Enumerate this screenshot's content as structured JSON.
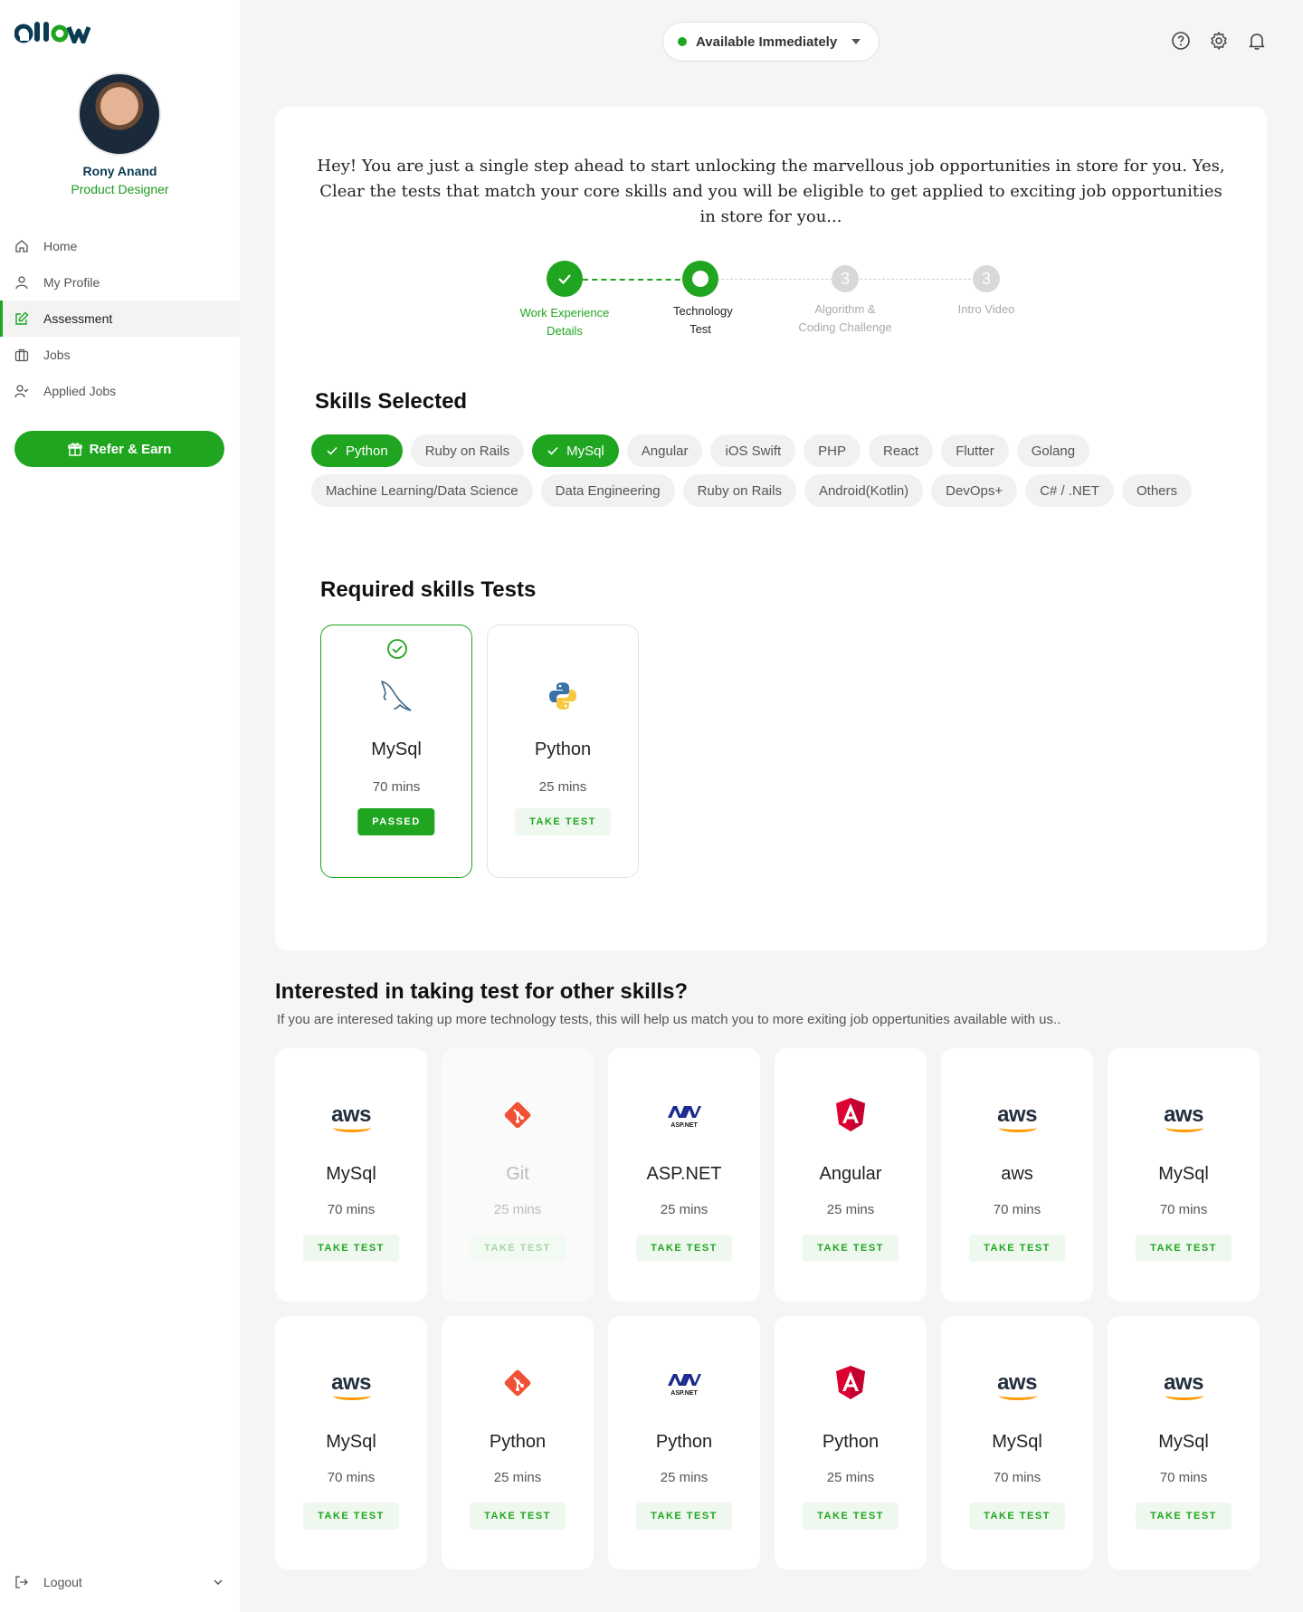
{
  "sidebar": {
    "logo": "ellow",
    "user_name": "Rony Anand",
    "user_role": "Product Designer",
    "nav": [
      {
        "label": "Home",
        "icon": "home-icon"
      },
      {
        "label": "My Profile",
        "icon": "user-icon"
      },
      {
        "label": "Assessment",
        "icon": "edit-icon",
        "active": true
      },
      {
        "label": "Jobs",
        "icon": "briefcase-icon"
      },
      {
        "label": "Applied Jobs",
        "icon": "user-check-icon"
      }
    ],
    "refer_label": "Refer & Earn",
    "logout_label": "Logout"
  },
  "topbar": {
    "availability": "Available Immediately"
  },
  "intro_text": "Hey! You are just a single step ahead to start unlocking the marvellous job opportunities in store for you. Yes, Clear the tests that match your core skills and you will be eligible to get applied to exciting job opportunities in store for you...",
  "steps": [
    {
      "label": "Work Experience Details",
      "state": "done"
    },
    {
      "label": "Technology Test",
      "state": "current"
    },
    {
      "label": "Algorithm & Coding Challenge",
      "state": "future",
      "number": "3"
    },
    {
      "label": "Intro Video",
      "state": "future",
      "number": "3"
    }
  ],
  "skills_title": "Skills Selected",
  "skills": [
    {
      "label": "Python",
      "selected": true
    },
    {
      "label": "Ruby on Rails"
    },
    {
      "label": "MySql",
      "selected": true
    },
    {
      "label": "Angular"
    },
    {
      "label": "iOS Swift"
    },
    {
      "label": "PHP"
    },
    {
      "label": "React"
    },
    {
      "label": "Flutter"
    },
    {
      "label": "Golang"
    },
    {
      "label": "Machine Learning/Data Science"
    },
    {
      "label": "Data Engineering"
    },
    {
      "label": "Ruby on Rails"
    },
    {
      "label": "Android(Kotlin)"
    },
    {
      "label": "DevOps+"
    },
    {
      "label": "C# / .NET"
    },
    {
      "label": "Others"
    }
  ],
  "required_title": "Required skills Tests",
  "required_tests": [
    {
      "name": "MySql",
      "mins": "70 mins",
      "button": "PASSED",
      "logo": "mysql-dolphin-icon",
      "passed": true
    },
    {
      "name": "Python",
      "mins": "25 mins",
      "button": "TAKE TEST",
      "logo": "python-icon"
    }
  ],
  "other_title": "Interested in taking test for other skills?",
  "other_subtitle": "If you are interesed taking up more technology tests, this will help us match you to more exiting job oppertunities available with us..",
  "other_tests": [
    {
      "name": "MySql",
      "mins": "70 mins",
      "button": "TAKE TEST",
      "logo": "aws"
    },
    {
      "name": "Git",
      "mins": "25 mins",
      "button": "TAKE TEST",
      "logo": "git",
      "faded": true
    },
    {
      "name": "ASP.NET",
      "mins": "25 mins",
      "button": "TAKE TEST",
      "logo": "aspnet"
    },
    {
      "name": "Angular",
      "mins": "25 mins",
      "button": "TAKE TEST",
      "logo": "angular"
    },
    {
      "name": "aws",
      "mins": "70 mins",
      "button": "TAKE TEST",
      "logo": "aws"
    },
    {
      "name": "MySql",
      "mins": "70 mins",
      "button": "TAKE TEST",
      "logo": "aws"
    },
    {
      "name": "MySql",
      "mins": "70 mins",
      "button": "TAKE TEST",
      "logo": "aws"
    },
    {
      "name": "Python",
      "mins": "25 mins",
      "button": "TAKE TEST",
      "logo": "git"
    },
    {
      "name": "Python",
      "mins": "25 mins",
      "button": "TAKE TEST",
      "logo": "aspnet"
    },
    {
      "name": "Python",
      "mins": "25 mins",
      "button": "TAKE TEST",
      "logo": "angular"
    },
    {
      "name": "MySql",
      "mins": "70 mins",
      "button": "TAKE TEST",
      "logo": "aws"
    },
    {
      "name": "MySql",
      "mins": "70 mins",
      "button": "TAKE TEST",
      "logo": "aws"
    }
  ],
  "colors": {
    "accent": "#1fa51f",
    "logo_dark": "#0b3a52"
  }
}
